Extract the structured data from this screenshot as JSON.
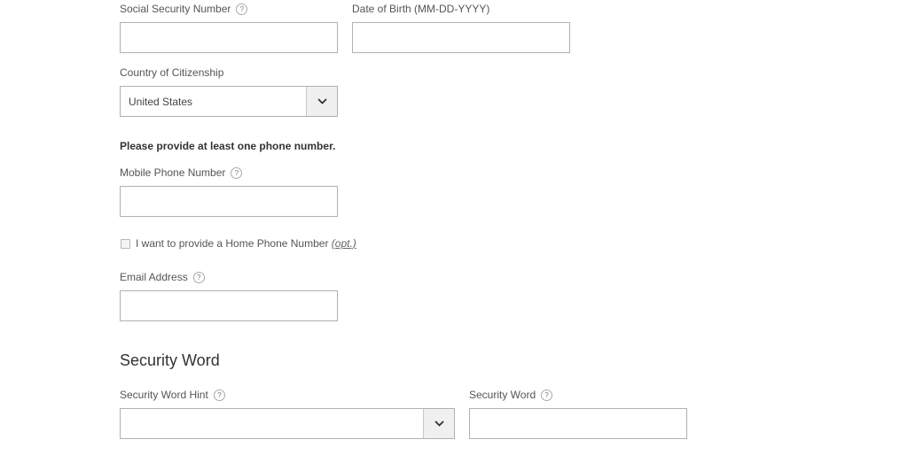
{
  "fields": {
    "ssn": {
      "label": "Social Security Number",
      "value": "",
      "placeholder": ""
    },
    "dob": {
      "label": "Date of Birth (MM-DD-YYYY)",
      "value": "",
      "placeholder": ""
    },
    "citizenship": {
      "label": "Country of Citizenship",
      "selected": "United States"
    },
    "phone_note": "Please provide at least one phone number.",
    "mobile": {
      "label": "Mobile Phone Number",
      "value": "",
      "placeholder": ""
    },
    "home_phone_checkbox": {
      "label": "I want to provide a Home Phone Number",
      "opt_label": "(opt.)",
      "checked": false
    },
    "email": {
      "label": "Email Address",
      "value": "",
      "placeholder": ""
    }
  },
  "security": {
    "heading": "Security Word",
    "hint": {
      "label": "Security Word Hint",
      "selected": ""
    },
    "word": {
      "label": "Security Word",
      "value": "",
      "placeholder": ""
    }
  },
  "help_glyph": "?",
  "icons": {
    "help": "question-circle-icon",
    "dropdown": "chevron-down-icon"
  }
}
